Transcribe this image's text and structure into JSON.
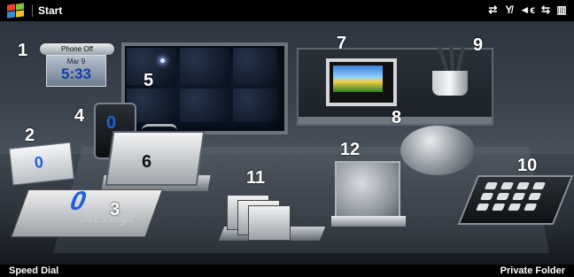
{
  "topbar": {
    "start_label": "Start",
    "status_icons": [
      "sync-icon",
      "signal-off-icon",
      "volume-icon",
      "connection-icon",
      "battery-icon"
    ]
  },
  "softkeys": {
    "left": "Speed Dial",
    "right": "Private Folder"
  },
  "clock_widget": {
    "phone_status": "Phone Off",
    "date": "Mar 9",
    "time": "5:33"
  },
  "hotspots": [
    {
      "number": "1"
    },
    {
      "number": "2"
    },
    {
      "number": "3"
    },
    {
      "number": "4"
    },
    {
      "number": "5"
    },
    {
      "number": "6"
    },
    {
      "number": "7"
    },
    {
      "number": "8"
    },
    {
      "number": "9"
    },
    {
      "number": "10"
    },
    {
      "number": "11"
    },
    {
      "number": "12"
    }
  ],
  "message_card": {
    "text": "Message"
  },
  "icons": {
    "windows_logo": "windows-flag-icon"
  }
}
